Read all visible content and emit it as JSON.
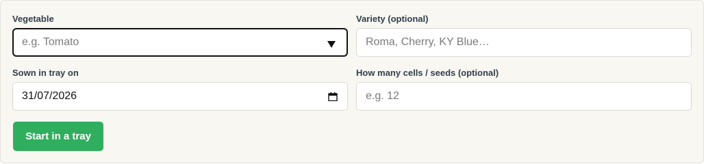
{
  "form": {
    "vegetable": {
      "label": "Vegetable",
      "placeholder": "e.g. Tomato",
      "icon": "chevron-down-icon"
    },
    "variety": {
      "label": "Variety (optional)",
      "placeholder": "Roma, Cherry, KY Blue…"
    },
    "sown": {
      "label": "Sown in tray on",
      "value": "31/07/2026",
      "icon": "calendar-icon"
    },
    "cells": {
      "label": "How many cells / seeds (optional)",
      "placeholder": "e.g. 12"
    },
    "submit_label": "Start in a tray"
  },
  "colors": {
    "panel_bg": "#f8f7f2",
    "label_text": "#2f3e4c",
    "button_bg": "#2fae5e",
    "button_text": "#ffffff",
    "focus_border": "#111111"
  }
}
